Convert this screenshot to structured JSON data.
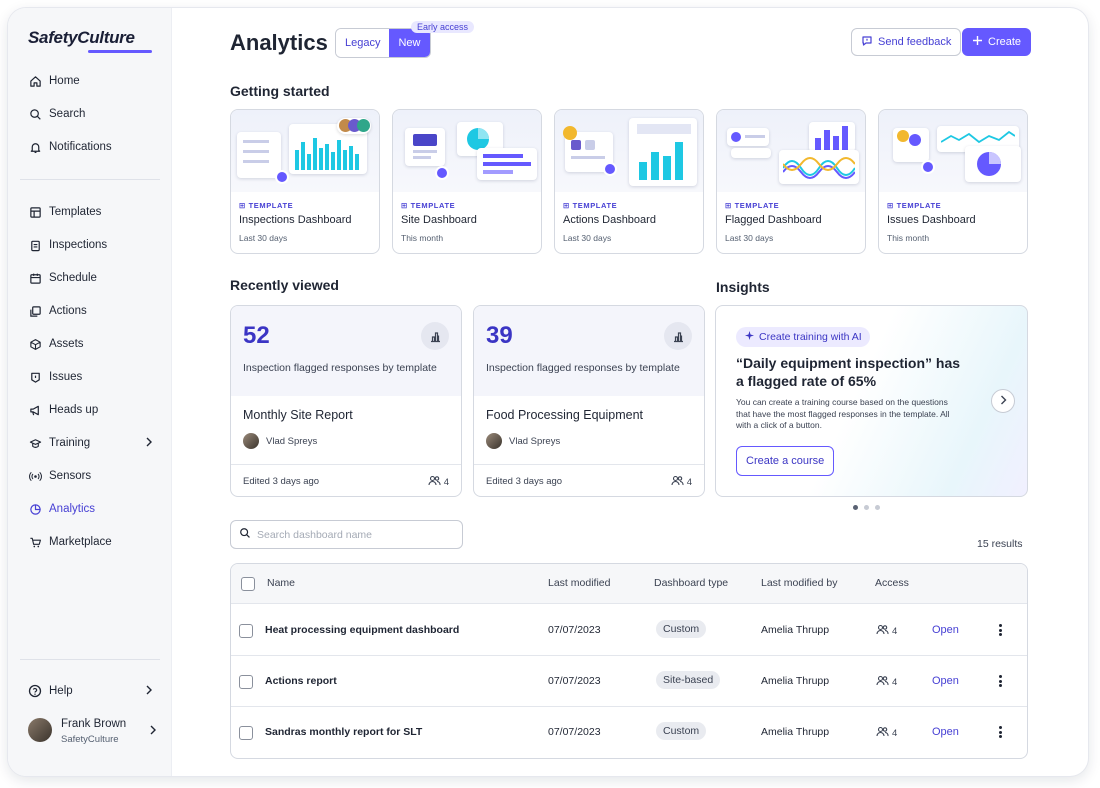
{
  "app": {
    "logo_text": "SafetyCulture",
    "page_title": "Analytics"
  },
  "sidebar": {
    "top_items": [
      {
        "label": "Home",
        "icon": "home-icon"
      },
      {
        "label": "Search",
        "icon": "search-icon"
      },
      {
        "label": "Notifications",
        "icon": "bell-icon"
      }
    ],
    "items": [
      {
        "label": "Templates",
        "icon": "template-icon"
      },
      {
        "label": "Inspections",
        "icon": "clipboard-icon"
      },
      {
        "label": "Schedule",
        "icon": "calendar-icon"
      },
      {
        "label": "Actions",
        "icon": "actions-icon"
      },
      {
        "label": "Assets",
        "icon": "cube-icon"
      },
      {
        "label": "Issues",
        "icon": "issue-icon"
      },
      {
        "label": "Heads up",
        "icon": "megaphone-icon"
      },
      {
        "label": "Training",
        "icon": "graduation-cap-icon"
      },
      {
        "label": "Sensors",
        "icon": "sensor-icon"
      },
      {
        "label": "Analytics",
        "icon": "analytics-icon"
      },
      {
        "label": "Marketplace",
        "icon": "cart-icon"
      }
    ],
    "active": "Analytics",
    "help_label": "Help",
    "user": {
      "name": "Frank Brown",
      "org": "SafetyCulture"
    }
  },
  "header": {
    "toggle": {
      "legacy": "Legacy",
      "new": "New",
      "selected": "New"
    },
    "early_access": "Early access",
    "send_feedback": "Send feedback",
    "create": "Create"
  },
  "getting_started": {
    "title": "Getting started",
    "tag": "TEMPLATE",
    "cards": [
      {
        "name": "Inspections Dashboard",
        "period": "Last 30 days"
      },
      {
        "name": "Site Dashboard",
        "period": "This month"
      },
      {
        "name": "Actions Dashboard",
        "period": "Last 30 days"
      },
      {
        "name": "Flagged Dashboard",
        "period": "Last 30 days"
      },
      {
        "name": "Issues Dashboard",
        "period": "This month"
      }
    ]
  },
  "recently_viewed": {
    "title": "Recently viewed",
    "cards": [
      {
        "value": "52",
        "desc": "Inspection flagged responses by template",
        "name": "Monthly Site Report",
        "author": "Vlad Spreys",
        "edited": "Edited 3 days ago",
        "access": "4"
      },
      {
        "value": "39",
        "desc": "Inspection flagged responses by template",
        "name": "Food Processing Equipment",
        "author": "Vlad Spreys",
        "edited": "Edited 3 days ago",
        "access": "4"
      }
    ]
  },
  "insights": {
    "title": "Insights",
    "pill": "Create training with AI",
    "quote": "“Daily equipment inspection” has a flagged rate of 65%",
    "body": "You can create a training course based on the questions that have the most flagged responses in the template. All with a click of a button.",
    "button": "Create a course",
    "carousel_pages": 3,
    "carousel_active": 1
  },
  "search": {
    "placeholder": "Search dashboard name",
    "value": ""
  },
  "results": "15 results",
  "table": {
    "headers": [
      "Name",
      "Last modified",
      "Dashboard type",
      "Last modified by",
      "Access"
    ],
    "rows": [
      {
        "name": "Heat processing equipment dashboard",
        "modified": "07/07/2023",
        "type": "Custom",
        "by": "Amelia Thrupp",
        "access": "4",
        "action": "Open"
      },
      {
        "name": "Actions report",
        "modified": "07/07/2023",
        "type": "Site-based",
        "by": "Amelia Thrupp",
        "access": "4",
        "action": "Open"
      },
      {
        "name": "Sandras monthly report for SLT",
        "modified": "07/07/2023",
        "type": "Custom",
        "by": "Amelia Thrupp",
        "access": "4",
        "action": "Open"
      }
    ]
  },
  "colors": {
    "accent": "#6559ff",
    "accent_text": "#4740d4",
    "sidebar_bg": "#f6f7f9"
  }
}
